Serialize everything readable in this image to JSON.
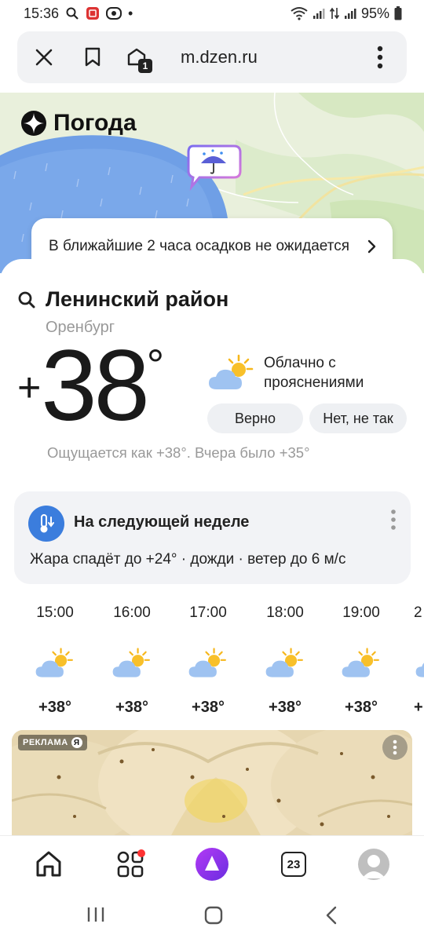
{
  "status_bar": {
    "time": "15:36",
    "battery": "95%",
    "dot": "•"
  },
  "browser": {
    "url": "m.dzen.ru",
    "tabs_count": "1",
    "icons": [
      "close-icon",
      "bookmark-icon",
      "tabs-icon",
      "more-vertical-icon"
    ]
  },
  "header": {
    "brand": "Погода",
    "precip_message": "В ближайшие 2 часа осадков не ожидается"
  },
  "current": {
    "location": "Ленинский район",
    "city": "Оренбург",
    "temp_sign": "+",
    "temp_value": "38",
    "temp_degree": "°",
    "condition": "Облачно с прояснениями",
    "feedback_yes": "Верно",
    "feedback_no": "Нет, не так",
    "feels_like": "Ощущается как +38°. Вчера было +35°"
  },
  "next_week": {
    "title": "На следующей неделе",
    "description": "Жара спадёт до +24° · дожди · ветер до 6 м/с"
  },
  "hourly": [
    {
      "time": "15:00",
      "temp": "+38°",
      "icon": "partly-cloudy-icon"
    },
    {
      "time": "16:00",
      "temp": "+38°",
      "icon": "partly-cloudy-icon"
    },
    {
      "time": "17:00",
      "temp": "+38°",
      "icon": "partly-cloudy-icon"
    },
    {
      "time": "18:00",
      "temp": "+38°",
      "icon": "partly-cloudy-icon"
    },
    {
      "time": "19:00",
      "temp": "+38°",
      "icon": "partly-cloudy-icon"
    },
    {
      "time": "2",
      "temp": "+",
      "icon": "partly-cloudy-icon"
    }
  ],
  "ad": {
    "label": "РЕКЛАМА",
    "mark": "Я"
  },
  "bottom_nav": {
    "calendar_day": "23",
    "items": [
      "home-icon",
      "services-icon",
      "alice-icon",
      "calendar-icon",
      "profile-avatar"
    ]
  },
  "colors": {
    "accent": "#3b7ddd",
    "alice": "#8a2be2",
    "text_muted": "#999999"
  }
}
